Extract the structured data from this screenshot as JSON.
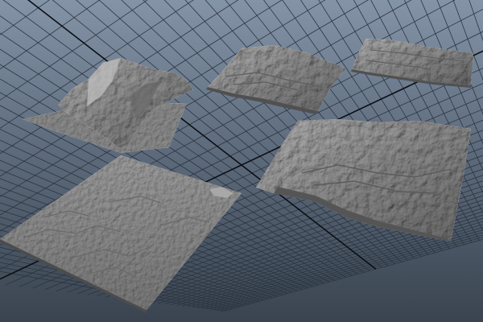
{
  "viewport": {
    "background_top": "#7f8fa2",
    "background_bottom": "#3d4754",
    "grid_color": "#2b3542",
    "grid_major_color": "#0c0f14",
    "terrain_color": "#8a8a8a",
    "terrain_dark": "#5a5a5a",
    "terrain_light": "#b6b6b6"
  },
  "terrains": [
    {
      "name": "mountain-terrain"
    },
    {
      "name": "ridged-plateau-terrain"
    },
    {
      "name": "strip-terrain"
    },
    {
      "name": "cliff-terrain"
    },
    {
      "name": "flat-crater-terrain"
    }
  ]
}
